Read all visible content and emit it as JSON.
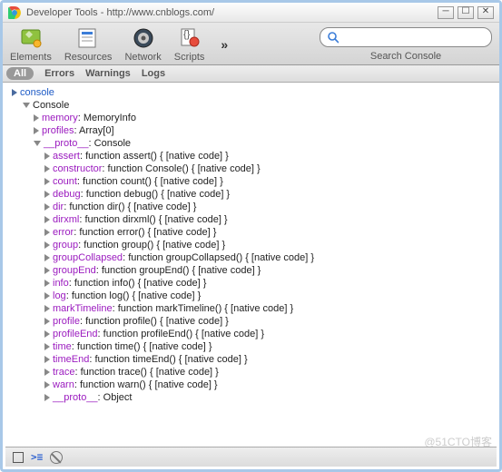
{
  "window": {
    "title": "Developer Tools - http://www.cnblogs.com/"
  },
  "toolbar": {
    "items": [
      {
        "label": "Elements",
        "icon": "elements"
      },
      {
        "label": "Resources",
        "icon": "resources"
      },
      {
        "label": "Network",
        "icon": "network"
      },
      {
        "label": "Scripts",
        "icon": "scripts"
      }
    ],
    "overflow": "»",
    "search_placeholder": "",
    "search_label": "Search Console"
  },
  "filters": {
    "all": "All",
    "errors": "Errors",
    "warnings": "Warnings",
    "logs": "Logs"
  },
  "console": {
    "input": "console",
    "root_label": "Console",
    "props": [
      {
        "name": "memory",
        "sig": "MemoryInfo",
        "open": false,
        "color": "purple"
      },
      {
        "name": "profiles",
        "sig": "Array[0]",
        "open": false,
        "color": "purple"
      },
      {
        "name": "__proto__",
        "sig": "Console",
        "open": true,
        "color": "purple",
        "children": [
          {
            "name": "assert",
            "sig": "function assert() { [native code] }",
            "color": "purple"
          },
          {
            "name": "constructor",
            "sig": "function Console() { [native code] }",
            "color": "purple"
          },
          {
            "name": "count",
            "sig": "function count() { [native code] }",
            "color": "purple"
          },
          {
            "name": "debug",
            "sig": "function debug() { [native code] }",
            "color": "purple"
          },
          {
            "name": "dir",
            "sig": "function dir() { [native code] }",
            "color": "purple"
          },
          {
            "name": "dirxml",
            "sig": "function dirxml() { [native code] }",
            "color": "purple"
          },
          {
            "name": "error",
            "sig": "function error() { [native code] }",
            "color": "purple"
          },
          {
            "name": "group",
            "sig": "function group() { [native code] }",
            "color": "purple"
          },
          {
            "name": "groupCollapsed",
            "sig": "function groupCollapsed() { [native code] }",
            "color": "purple"
          },
          {
            "name": "groupEnd",
            "sig": "function groupEnd() { [native code] }",
            "color": "purple"
          },
          {
            "name": "info",
            "sig": "function info() { [native code] }",
            "color": "purple"
          },
          {
            "name": "log",
            "sig": "function log() { [native code] }",
            "color": "purple"
          },
          {
            "name": "markTimeline",
            "sig": "function markTimeline() { [native code] }",
            "color": "purple"
          },
          {
            "name": "profile",
            "sig": "function profile() { [native code] }",
            "color": "purple"
          },
          {
            "name": "profileEnd",
            "sig": "function profileEnd() { [native code] }",
            "color": "purple"
          },
          {
            "name": "time",
            "sig": "function time() { [native code] }",
            "color": "purple"
          },
          {
            "name": "timeEnd",
            "sig": "function timeEnd() { [native code] }",
            "color": "purple"
          },
          {
            "name": "trace",
            "sig": "function trace() { [native code] }",
            "color": "purple"
          },
          {
            "name": "warn",
            "sig": "function warn() { [native code] }",
            "color": "purple"
          },
          {
            "name": "__proto__",
            "sig": "Object",
            "color": "purple"
          }
        ]
      }
    ]
  },
  "watermark": "@51CTO博客"
}
